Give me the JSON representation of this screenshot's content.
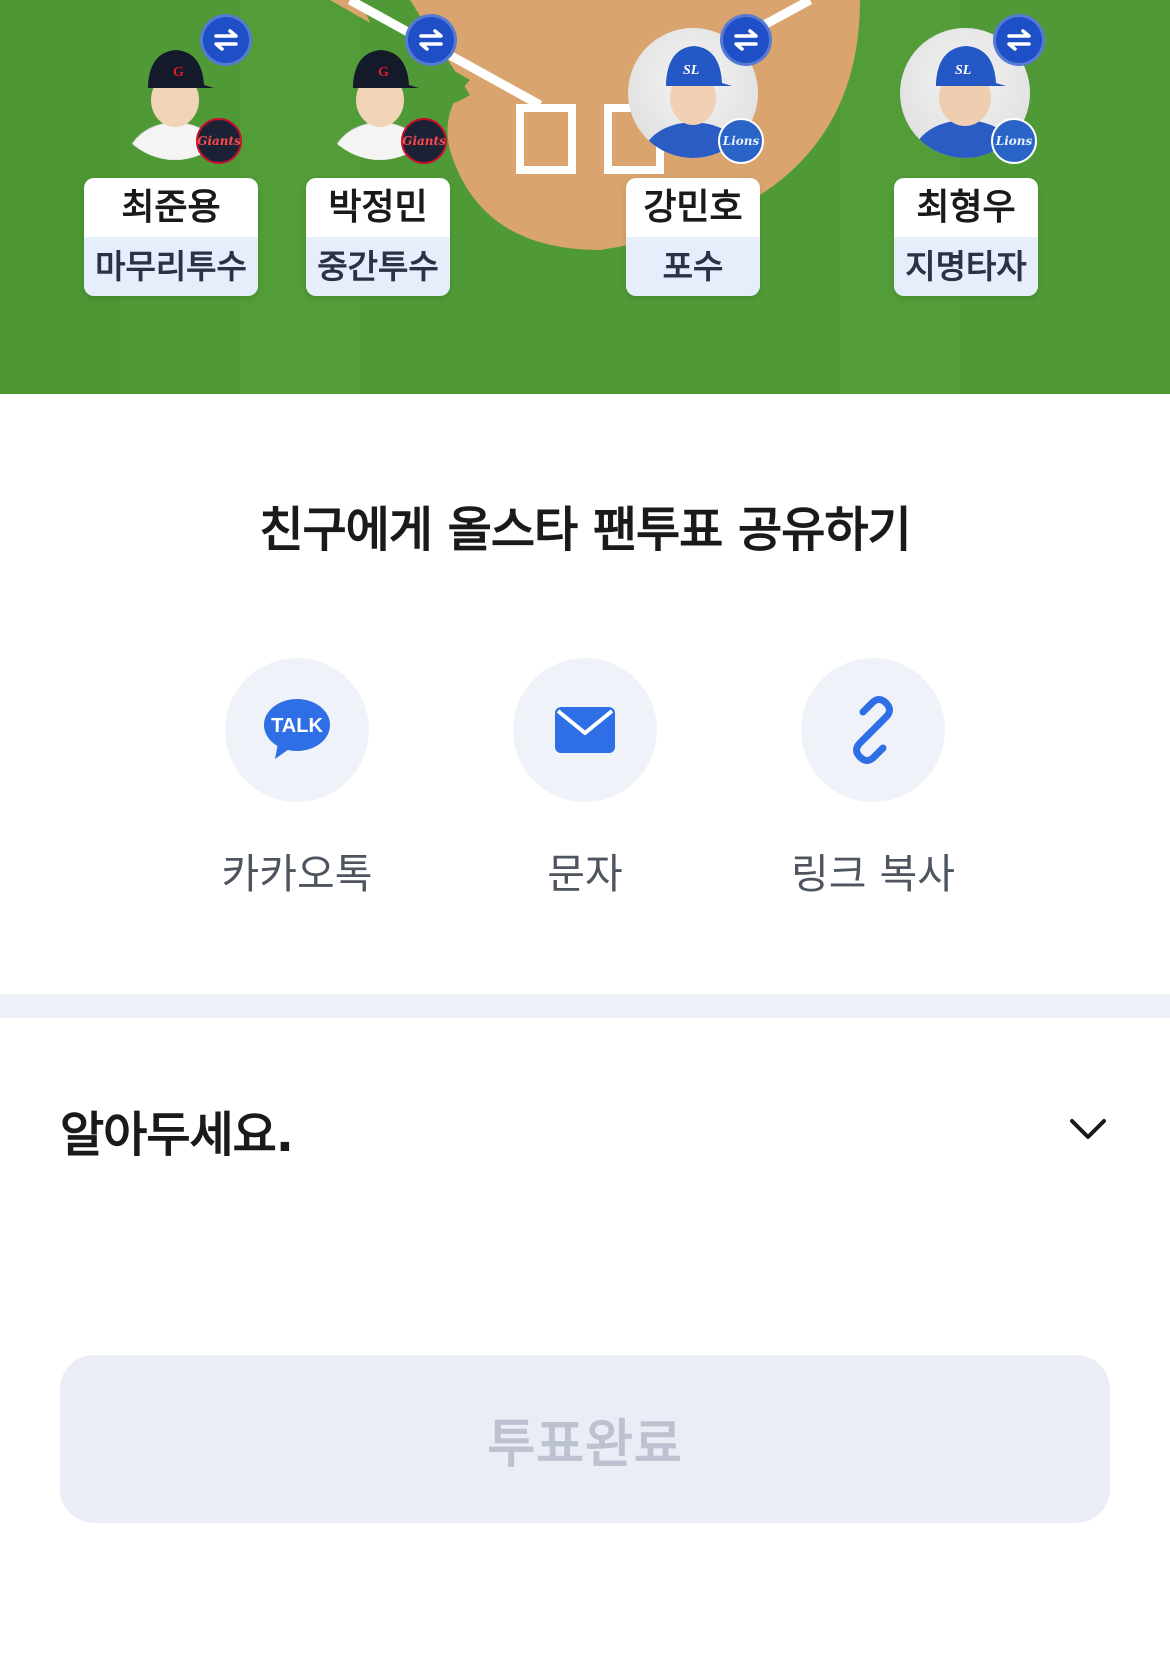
{
  "players": [
    {
      "name": "최준용",
      "position": "마무리투수",
      "team_icon": "giants-logo-icon",
      "team_text": "Giants",
      "swap_icon": "swap-arrows-icon"
    },
    {
      "name": "박정민",
      "position": "중간투수",
      "team_icon": "giants-logo-icon",
      "team_text": "Giants",
      "swap_icon": "swap-arrows-icon"
    },
    {
      "name": "강민호",
      "position": "포수",
      "team_icon": "lions-logo-icon",
      "team_text": "Lions",
      "swap_icon": "swap-arrows-icon"
    },
    {
      "name": "최형우",
      "position": "지명타자",
      "team_icon": "lions-logo-icon",
      "team_text": "Lions",
      "swap_icon": "swap-arrows-icon"
    }
  ],
  "share": {
    "title": "친구에게 올스타 팬투표 공유하기",
    "buttons": [
      {
        "label": "카카오톡",
        "icon": "kakaotalk-icon",
        "icon_text": "TALK"
      },
      {
        "label": "문자",
        "icon": "envelope-icon"
      },
      {
        "label": "링크 복사",
        "icon": "link-icon"
      }
    ]
  },
  "notice": {
    "title": "알아두세요.",
    "icon": "chevron-down-icon"
  },
  "complete_button": {
    "label": "투표완료",
    "disabled": true
  },
  "colors": {
    "field_green": "#4f9a36",
    "infield_dirt": "#d9a46e",
    "swap_blue": "#1f4fc6",
    "accent_blue": "#2f6fe6",
    "kakao_talk_blue": "#2f6fe6",
    "position_bg": "#e6eefc",
    "disabled_button_bg": "#eaedf6",
    "disabled_button_text": "#bcc2cf",
    "divider": "#eef1f7"
  }
}
